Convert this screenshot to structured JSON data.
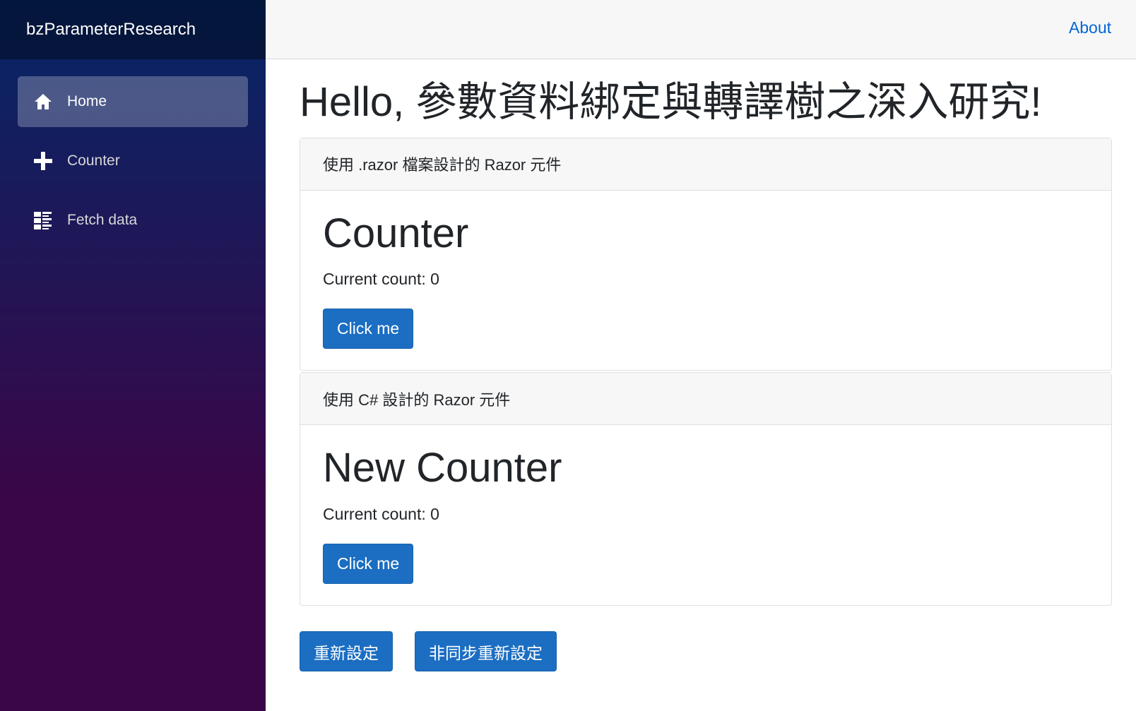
{
  "sidebar": {
    "brand": "bzParameterResearch",
    "items": [
      {
        "label": "Home",
        "icon": "home-icon",
        "active": true
      },
      {
        "label": "Counter",
        "icon": "plus-icon",
        "active": false
      },
      {
        "label": "Fetch data",
        "icon": "list-icon",
        "active": false
      }
    ]
  },
  "topbar": {
    "about": "About"
  },
  "main": {
    "title": "Hello, 參數資料綁定與轉譯樹之深入研究!",
    "cards": [
      {
        "header": "使用 .razor 檔案設計的 Razor 元件",
        "title": "Counter",
        "count_text": "Current count: 0",
        "button": "Click me"
      },
      {
        "header": "使用 C# 設計的 Razor 元件",
        "title": "New Counter",
        "count_text": "Current count: 0",
        "button": "Click me"
      }
    ],
    "reset_button": "重新設定",
    "async_reset_button": "非同步重新設定"
  },
  "colors": {
    "accent": "#1b6ec2",
    "link": "#0366d6",
    "sidebar_top": "#052767",
    "sidebar_bottom": "#3a0647"
  }
}
